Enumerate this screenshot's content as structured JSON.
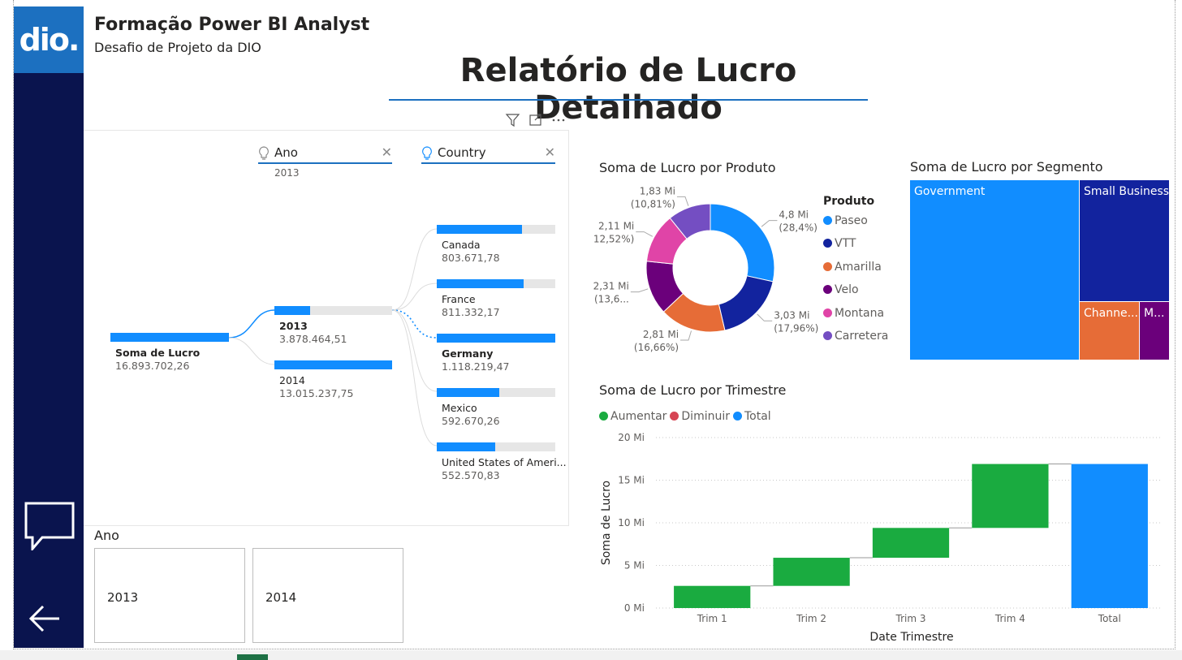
{
  "header": {
    "logo_text": "dio.",
    "title": "Formação Power BI Analyst",
    "subtitle": "Desafio de Projeto da DIO",
    "page_title": "Relatório de Lucro Detalhado"
  },
  "sidebar": {
    "icons": [
      "chat-icon",
      "back-arrow-icon"
    ]
  },
  "decomposition_tree": {
    "levels": [
      {
        "label": "Ano",
        "selected": "2013"
      },
      {
        "label": "Country",
        "selected": ""
      }
    ],
    "root": {
      "label": "Soma de Lucro",
      "value": "16.893.702,26"
    },
    "years": [
      {
        "label": "2013",
        "value": "3.878.464,51",
        "fraction": 0.3,
        "selected": true
      },
      {
        "label": "2014",
        "value": "13.015.237,75",
        "fraction": 1.0,
        "selected": false
      }
    ],
    "countries": [
      {
        "label": "Canada",
        "value": "803.671,78",
        "fraction": 0.72
      },
      {
        "label": "France",
        "value": "811.332,17",
        "fraction": 0.73
      },
      {
        "label": "Germany",
        "value": "1.118.219,47",
        "fraction": 1.0,
        "selected": true
      },
      {
        "label": "Mexico",
        "value": "592.670,26",
        "fraction": 0.53
      },
      {
        "label": "United States of Ameri...",
        "value": "552.570,83",
        "fraction": 0.49
      }
    ]
  },
  "slicer": {
    "label": "Ano",
    "options": [
      "2013",
      "2014"
    ]
  },
  "chart_data": [
    {
      "type": "pie",
      "title": "Soma de Lucro por Produto",
      "legend_title": "Produto",
      "legend_position": "right",
      "categories": [
        "Paseo",
        "VTT",
        "Amarilla",
        "Velo",
        "Montana",
        "Carretera"
      ],
      "values": [
        4.8,
        3.03,
        2.81,
        2.31,
        2.11,
        1.83
      ],
      "colors": [
        "#118DFF",
        "#12239E",
        "#E66C37",
        "#6B007B",
        "#E044A7",
        "#744EC2"
      ],
      "data_labels": [
        "4,8 Mi",
        "3,03 Mi",
        "2,81 Mi",
        "2,31 Mi",
        "2,11 Mi",
        "1,83 Mi"
      ],
      "percent_labels": [
        "(28,4%)",
        "(17,96%)",
        "(16,66%)",
        "(13,6...",
        "(12,52%)",
        "(10,81%)"
      ]
    },
    {
      "type": "heatmap",
      "subtype": "treemap",
      "title": "Soma de Lucro por Segmento",
      "categories": [
        "Government",
        "Small Business",
        "Channe...",
        "M..."
      ],
      "values": [
        11.39,
        4.14,
        1.32,
        0.66
      ],
      "colors": [
        "#118DFF",
        "#12239E",
        "#E66C37",
        "#6B007B"
      ]
    },
    {
      "type": "bar",
      "subtype": "waterfall",
      "title": "Soma de Lucro por Trimestre",
      "xlabel": "Date Trimestre",
      "ylabel": "Soma de Lucro",
      "categories": [
        "Trim 1",
        "Trim 2",
        "Trim 3",
        "Trim 4",
        "Total"
      ],
      "values": [
        2.6,
        3.3,
        3.5,
        7.5,
        16.9
      ],
      "ylim": [
        0,
        20
      ],
      "yticks": [
        "0 Mi",
        "5 Mi",
        "10 Mi",
        "15 Mi",
        "20 Mi"
      ],
      "grid": true,
      "legend": [
        "Aumentar",
        "Diminuir",
        "Total"
      ],
      "legend_colors": [
        "#1AAB40",
        "#D64554",
        "#118DFF"
      ],
      "legend_position": "top-left"
    }
  ]
}
